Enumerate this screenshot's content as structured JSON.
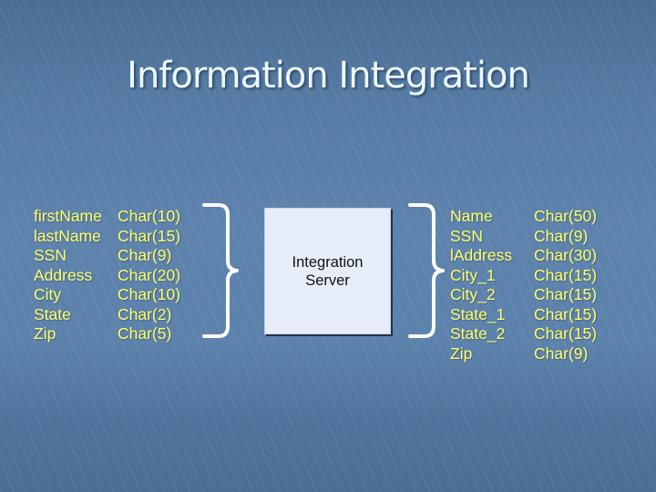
{
  "slide": {
    "title": "Information Integration",
    "colors": {
      "background": "#557aa3",
      "title_text": "#ecf8ff",
      "field_text": "#ffff66",
      "server_box": "#e6edf8",
      "brace": "#ffffff"
    }
  },
  "source_schema": {
    "fields": [
      {
        "name": "firstName",
        "type": "Char(10)"
      },
      {
        "name": "lastName",
        "type": "Char(15)"
      },
      {
        "name": "SSN",
        "type": "Char(9)"
      },
      {
        "name": "Address",
        "type": "Char(20)"
      },
      {
        "name": "City",
        "type": "Char(10)"
      },
      {
        "name": "State",
        "type": "Char(2)"
      },
      {
        "name": "Zip",
        "type": "Char(5)"
      }
    ]
  },
  "server": {
    "line1": "Integration",
    "line2": "Server"
  },
  "target_schema": {
    "fields": [
      {
        "name": "Name",
        "type": "Char(50)"
      },
      {
        "name": "SSN",
        "type": "Char(9)"
      },
      {
        "name": "lAddress",
        "type": "Char(30)"
      },
      {
        "name": "City_1",
        "type": "Char(15)"
      },
      {
        "name": "City_2",
        "type": "Char(15)"
      },
      {
        "name": "State_1",
        "type": "Char(15)"
      },
      {
        "name": "State_2",
        "type": "Char(15)"
      },
      {
        "name": "Zip",
        "type": "Char(9)"
      }
    ]
  }
}
